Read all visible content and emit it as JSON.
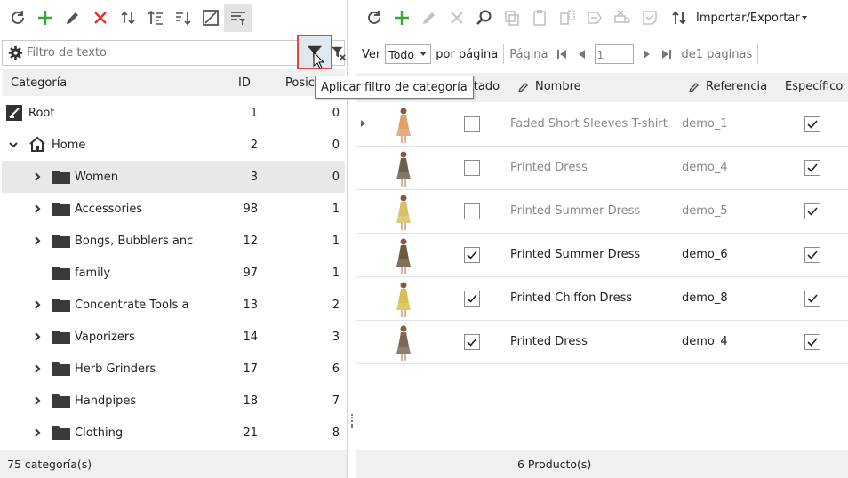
{
  "colors": {
    "refresh": "#555555",
    "add": "#3aa63a",
    "delete": "#d9342b",
    "highlight_border": "#e0483f"
  },
  "left": {
    "toolbar": {
      "icons": [
        "refresh-icon",
        "add-icon",
        "edit-icon",
        "delete-icon",
        "move-up-down-icon",
        "sort-asc-icon",
        "sort-desc-icon",
        "image-icon",
        "filter-list-icon"
      ]
    },
    "filter": {
      "placeholder": "Filtro de texto",
      "value": ""
    },
    "header": {
      "category": "Categoría",
      "id": "ID",
      "position": "Posic"
    },
    "categories": [
      {
        "name": "Root",
        "id": "1",
        "pos": "0"
      },
      {
        "name": "Home",
        "id": "2",
        "pos": "0"
      },
      {
        "name": "Women",
        "id": "3",
        "pos": "0"
      },
      {
        "name": "Accessories",
        "id": "98",
        "pos": "1"
      },
      {
        "name": "Bongs, Bubblers anc",
        "id": "12",
        "pos": "1"
      },
      {
        "name": "family",
        "id": "97",
        "pos": "1"
      },
      {
        "name": "Concentrate Tools a",
        "id": "13",
        "pos": "2"
      },
      {
        "name": "Vaporizers",
        "id": "14",
        "pos": "3"
      },
      {
        "name": "Herb Grinders",
        "id": "17",
        "pos": "6"
      },
      {
        "name": "Handpipes",
        "id": "18",
        "pos": "7"
      },
      {
        "name": "Clothing",
        "id": "21",
        "pos": "8"
      }
    ],
    "footer": "75 categoría(s)"
  },
  "tooltip": "Aplicar filtro de categoría",
  "right": {
    "toolbar": {
      "import_export": "Importar/Exportar"
    },
    "pager": {
      "ver": "Ver",
      "per_page_value": "Todo",
      "por_pagina": "por página",
      "pagina": "Página",
      "page_value": "1",
      "of_pages": "de1 paginas"
    },
    "header": {
      "estado": "stado",
      "nombre": "Nombre",
      "referencia": "Referencia",
      "especifico": "Específico"
    },
    "products": [
      {
        "estado": false,
        "name": "Faded Short Sleeves T-shirt",
        "ref": "demo_1",
        "specific": true
      },
      {
        "estado": false,
        "name": "Printed Dress",
        "ref": "demo_4",
        "specific": true
      },
      {
        "estado": false,
        "name": "Printed Summer Dress",
        "ref": "demo_5",
        "specific": true
      },
      {
        "estado": true,
        "name": "Printed Summer Dress",
        "ref": "demo_6",
        "specific": true
      },
      {
        "estado": true,
        "name": "Printed Chiffon Dress",
        "ref": "demo_8",
        "specific": true
      },
      {
        "estado": true,
        "name": "Printed Dress",
        "ref": "demo_4",
        "specific": true
      }
    ],
    "footer": "6 Producto(s)"
  }
}
